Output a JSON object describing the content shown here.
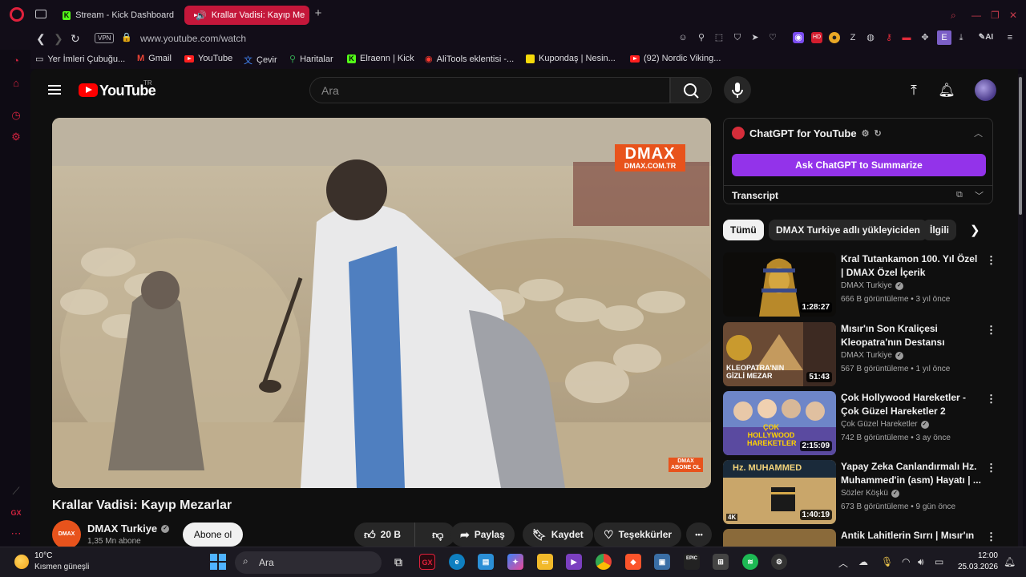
{
  "browser": {
    "tabs": [
      {
        "title": "Stream - Kick Dashboard",
        "favicon": "kick-icon"
      },
      {
        "title": "Krallar Vadisi: Kayıp Me",
        "favicon": "youtube-icon",
        "active": true,
        "audio": "speaker-icon"
      }
    ],
    "vpn_label": "VPN",
    "url": "www.youtube.com/watch",
    "ai_label": "AI",
    "ext_letter": "E",
    "bookmarks": [
      {
        "label": "Yer İmleri Çubuğu...",
        "icon": "folder-icon"
      },
      {
        "label": "Gmail",
        "icon": "gmail-icon"
      },
      {
        "label": "YouTube",
        "icon": "youtube-icon"
      },
      {
        "label": "Çevir",
        "icon": "translate-icon"
      },
      {
        "label": "Haritalar",
        "icon": "maps-icon"
      },
      {
        "label": "Elraenn | Kick",
        "icon": "kick-icon"
      },
      {
        "label": "AliTools eklentisi -...",
        "icon": "alitools-icon"
      },
      {
        "label": "Kupondaş | Nesin...",
        "icon": "kupondas-icon"
      },
      {
        "label": "(92) Nordic Viking...",
        "icon": "youtube-icon"
      }
    ],
    "sidebar_gx_label": "GX"
  },
  "youtube": {
    "logo_text": "YouTube",
    "country_code": "TR",
    "search_placeholder": "Ara",
    "video": {
      "watermark_big": "DMAX",
      "watermark_url": "DMAX.COM.TR",
      "watermark_small": "DMAX",
      "watermark_small_sub": "ABONE OL"
    },
    "title": "Krallar Vadisi: Kayıp Mezarlar",
    "channel": {
      "avatar_text": "DMAX",
      "name": "DMAX Turkiye",
      "subscribers": "1,35 Mn abone",
      "subscribe_label": "Abone ol"
    },
    "actions": {
      "likes": "20 B",
      "share": "Paylaş",
      "save": "Kaydet",
      "thanks": "Teşekkürler",
      "more": "•••"
    },
    "chatgpt": {
      "title": "ChatGPT for YouTube",
      "summarize_button": "Ask ChatGPT to Summarize",
      "transcript_label": "Transcript"
    },
    "chips": [
      "Tümü",
      "DMAX Turkiye adlı yükleyiciden",
      "İlgili"
    ],
    "recommendations": [
      {
        "title": "Kral Tutankamon 100. Yıl Özel | DMAX Özel İçerik",
        "channel": "DMAX Turkiye",
        "meta": "666 B görüntüleme • 3 yıl önce",
        "duration": "1:28:27"
      },
      {
        "title": "Mısır'ın Son Kraliçesi Kleopatra'nın Destansı Hikaye...",
        "channel": "DMAX Turkiye",
        "meta": "567 B görüntüleme • 1 yıl önce",
        "duration": "51:43",
        "thumb_text": "KLEOPATRA'NIN GİZLİ MEZAR"
      },
      {
        "title": "Çok Hollywood Hareketler - Çok Güzel Hareketler 2",
        "channel": "Çok Güzel Hareketler",
        "meta": "742 B görüntüleme • 3 ay önce",
        "duration": "2:15:09",
        "thumb_text": "ÇOK HOLLYWOOD HAREKETLER"
      },
      {
        "title": "Yapay Zeka Canlandırmalı Hz. Muhammed'in (asm) Hayatı | ...",
        "channel": "Sözler Köşkü",
        "meta": "673 B görüntüleme • 9 gün önce",
        "duration": "1:40:19",
        "badge": "4K",
        "thumb_text": "Hz. MUHAMMED"
      },
      {
        "title": "Antik Lahitlerin Sırrı | Mısır'ın",
        "channel": "",
        "meta": "",
        "duration": ""
      }
    ]
  },
  "taskbar": {
    "temperature": "10°C",
    "weather": "Kısmen güneşli",
    "search_placeholder": "Ara",
    "gx_label": "GX",
    "epic_label": "EPIC",
    "time": "12:00",
    "date": "25.03.2026"
  },
  "colors": {
    "opera_red": "#e0213c",
    "active_tab": "#c4173a",
    "youtube_red": "#ff0000",
    "chatgpt_purple": "#9333ea",
    "dmax_orange": "#e8531c"
  }
}
